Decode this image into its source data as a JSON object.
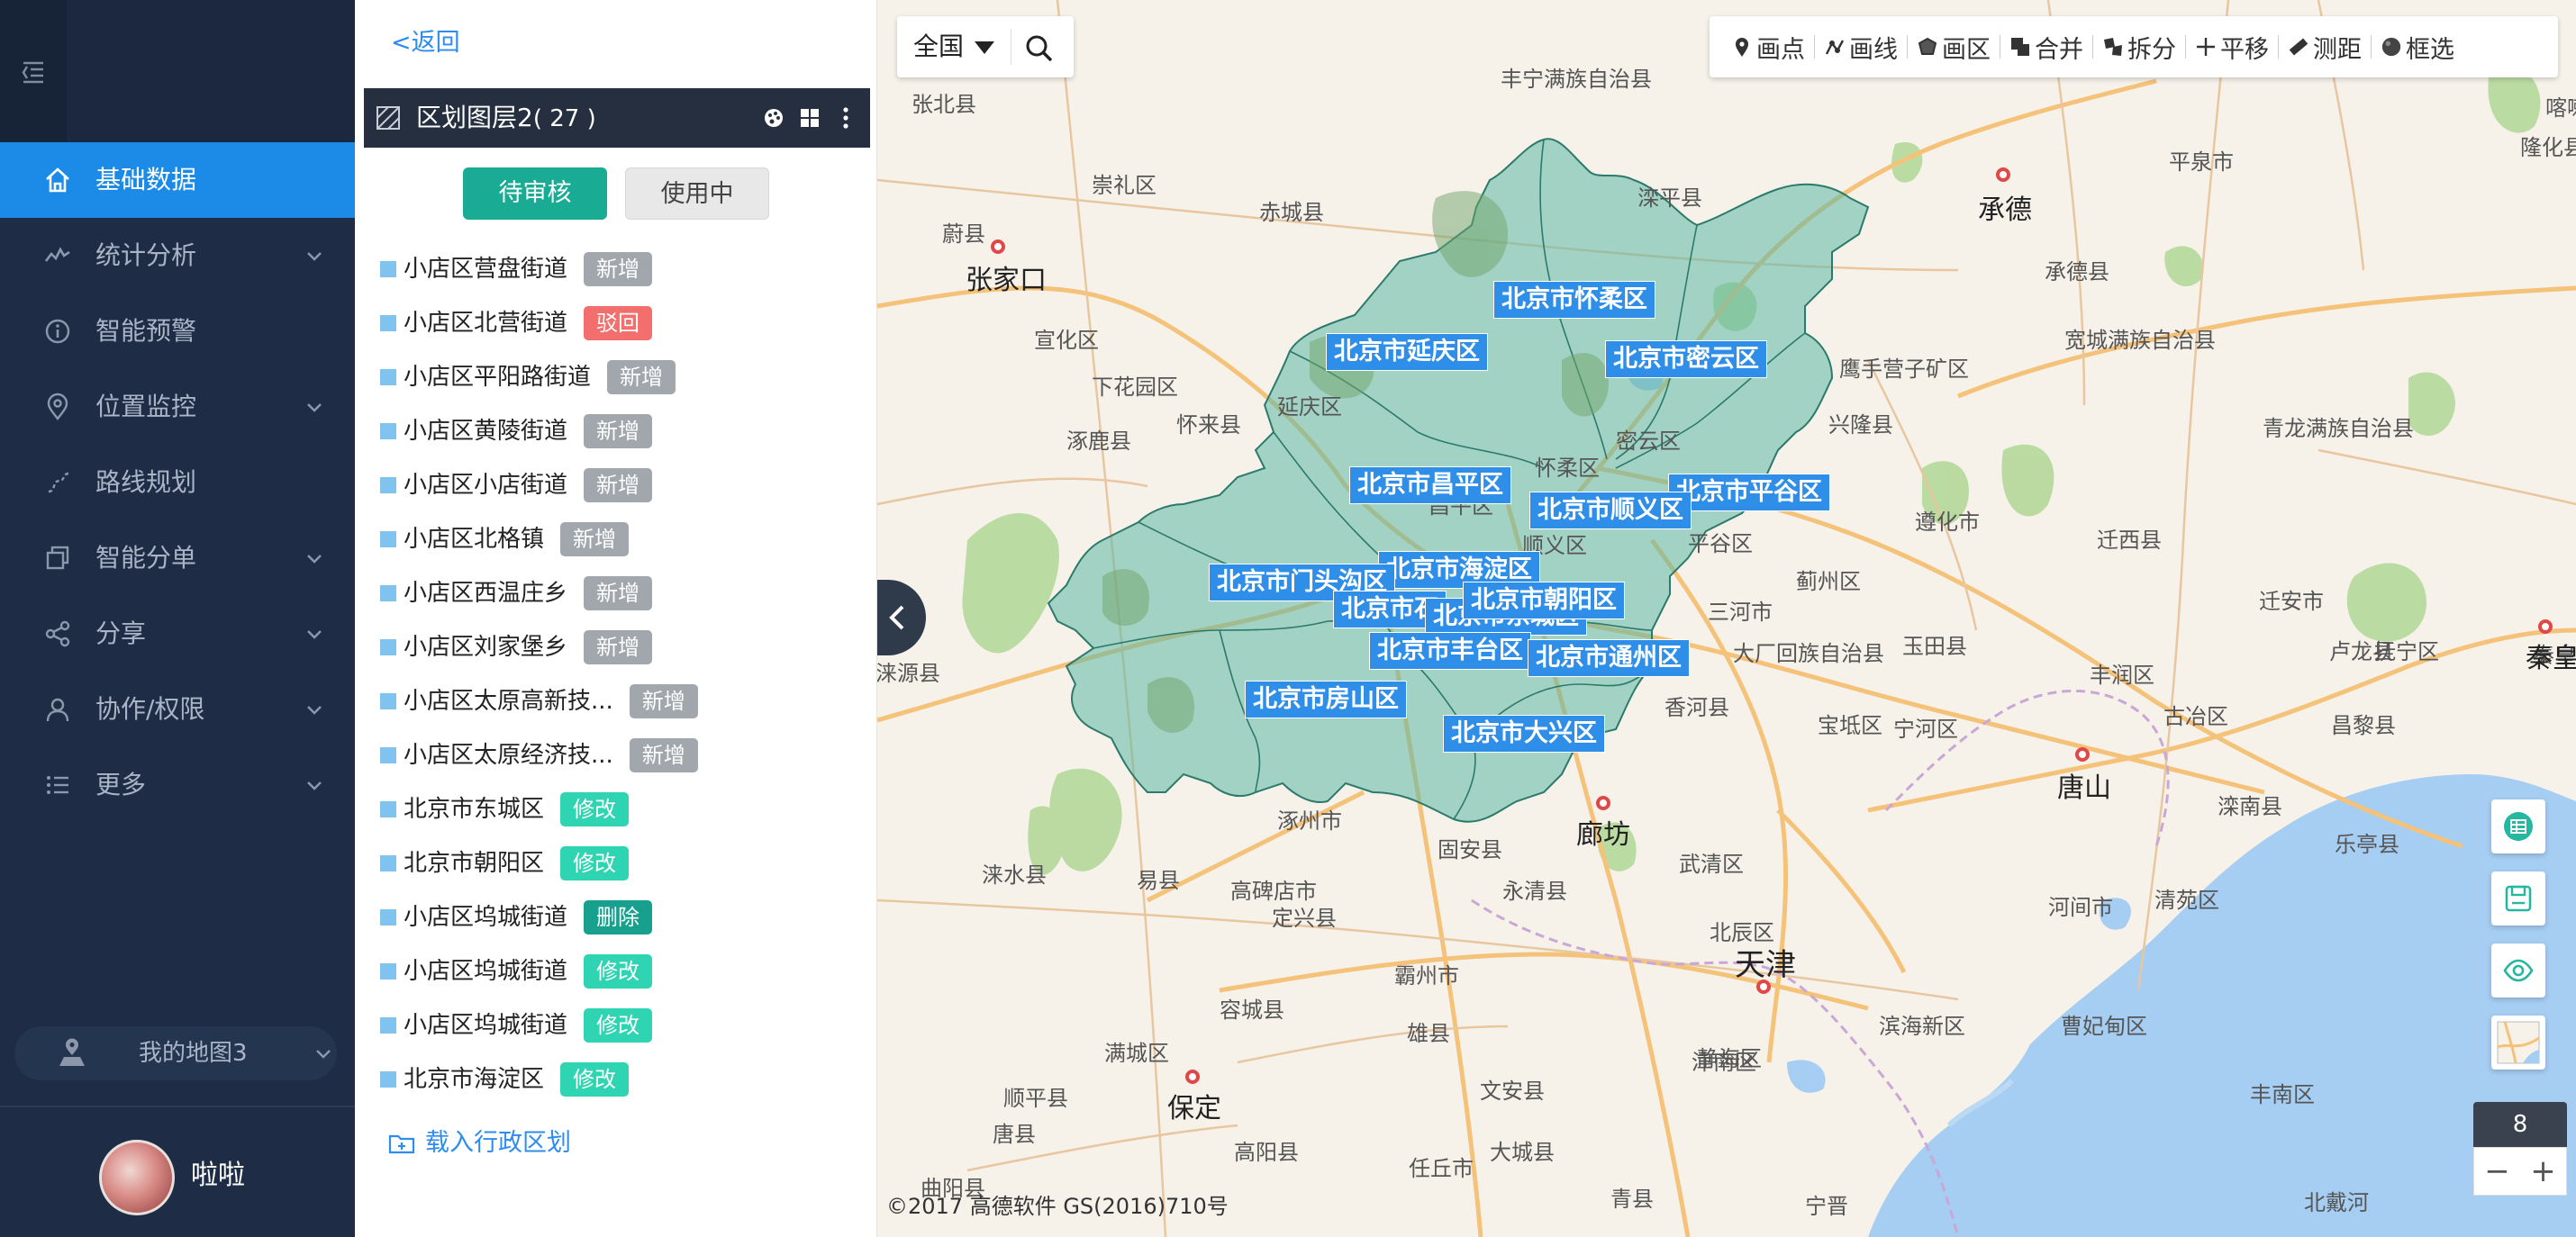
{
  "sidebar": {
    "nav": [
      {
        "label": "基础数据",
        "icon": "home-icon",
        "active": true
      },
      {
        "label": "统计分析",
        "icon": "chart-icon",
        "expandable": true
      },
      {
        "label": "智能预警",
        "icon": "info-icon"
      },
      {
        "label": "位置监控",
        "icon": "location-pin-icon",
        "expandable": true
      },
      {
        "label": "路线规划",
        "icon": "route-icon"
      },
      {
        "label": "智能分单",
        "icon": "copy-icon",
        "expandable": true
      },
      {
        "label": "分享",
        "icon": "share-icon",
        "expandable": true
      },
      {
        "label": "协作/权限",
        "icon": "user-icon",
        "expandable": true
      },
      {
        "label": "更多",
        "icon": "list-icon",
        "expandable": true
      }
    ],
    "my_map": "我的地图3",
    "user": {
      "name": "啦啦"
    }
  },
  "panel": {
    "back": "<返回",
    "layer_title": "区划图层2",
    "layer_count": "( 27 )",
    "tabs": {
      "pending": "待审核",
      "in_use": "使用中"
    },
    "items": [
      {
        "name": "小店区营盘街道",
        "status": "新增"
      },
      {
        "name": "小店区北营街道",
        "status": "驳回"
      },
      {
        "name": "小店区平阳路街道",
        "status": "新增"
      },
      {
        "name": "小店区黄陵街道",
        "status": "新增"
      },
      {
        "name": "小店区小店街道",
        "status": "新增"
      },
      {
        "name": "小店区北格镇",
        "status": "新增"
      },
      {
        "name": "小店区西温庄乡",
        "status": "新增"
      },
      {
        "name": "小店区刘家堡乡",
        "status": "新增"
      },
      {
        "name": "小店区太原高新技...",
        "status": "新增"
      },
      {
        "name": "小店区太原经济技...",
        "status": "新增"
      },
      {
        "name": "北京市东城区",
        "status": "修改"
      },
      {
        "name": "北京市朝阳区",
        "status": "修改"
      },
      {
        "name": "小店区坞城街道",
        "status": "删除"
      },
      {
        "name": "小店区坞城街道",
        "status": "修改"
      },
      {
        "name": "小店区坞城街道",
        "status": "修改"
      },
      {
        "name": "北京市海淀区",
        "status": "修改"
      }
    ],
    "load_admin": "载入行政区划"
  },
  "map": {
    "region": "全国",
    "toolbar": [
      "画点",
      "画线",
      "画区",
      "合并",
      "拆分",
      "平移",
      "测距",
      "框选"
    ],
    "zoom_level": "8",
    "copyright": "©2017 高德软件 GS(2016)710号",
    "district_labels": [
      "北京市怀柔区",
      "北京市延庆区",
      "北京市密云区",
      "北京市昌平区",
      "北京市平谷区",
      "北京市顺义区",
      "北京市海淀区",
      "北京市门头沟区",
      "北京市朝阳区",
      "北京市丰台区",
      "北京市通州区",
      "北京市房山区",
      "北京市大兴区",
      "北京市石",
      "北京市东城区"
    ],
    "places": [
      "丰宁满族自治县",
      "张北县",
      "崇礼区",
      "赤城县",
      "滦平县",
      "平泉市",
      "承德县",
      "宣化区",
      "下花园区",
      "涿鹿县",
      "怀来县",
      "延庆区",
      "怀柔区",
      "密云区",
      "兴隆县",
      "鹰手营子矿区",
      "宽城满族自治县",
      "青龙满族自治县",
      "遵化市",
      "迁西县",
      "迁安市",
      "卢龙县",
      "抚宁区",
      "玉田县",
      "丰润区",
      "古冶区",
      "昌黎县",
      "滦南县",
      "乐亭县",
      "昌平区",
      "顺义区",
      "平谷区",
      "三河市",
      "蓟州区",
      "大厂回族自治县",
      "香河县",
      "宝坻区",
      "宁河区",
      "涿州市",
      "固安县",
      "永清县",
      "武清区",
      "北辰区",
      "易县",
      "涞水县",
      "高碑店市",
      "定兴县",
      "霸州市",
      "容城县",
      "雄县",
      "文安县",
      "静海区",
      "津南区",
      "滨海新区",
      "满城区",
      "顺平县",
      "唐县",
      "高阳县",
      "任丘市",
      "大城县",
      "青县",
      "曹妃甸区",
      "曲阳县",
      "蔚县",
      "涞源县",
      "喀喇沁",
      "隆化县",
      "河间市",
      "宁晋",
      "秦皇岛",
      "丰南区",
      "清苑区",
      "北戴河"
    ],
    "cities": [
      "张家口",
      "承德",
      "廊坊",
      "天津",
      "唐山",
      "保定",
      "秦皇岛"
    ]
  }
}
